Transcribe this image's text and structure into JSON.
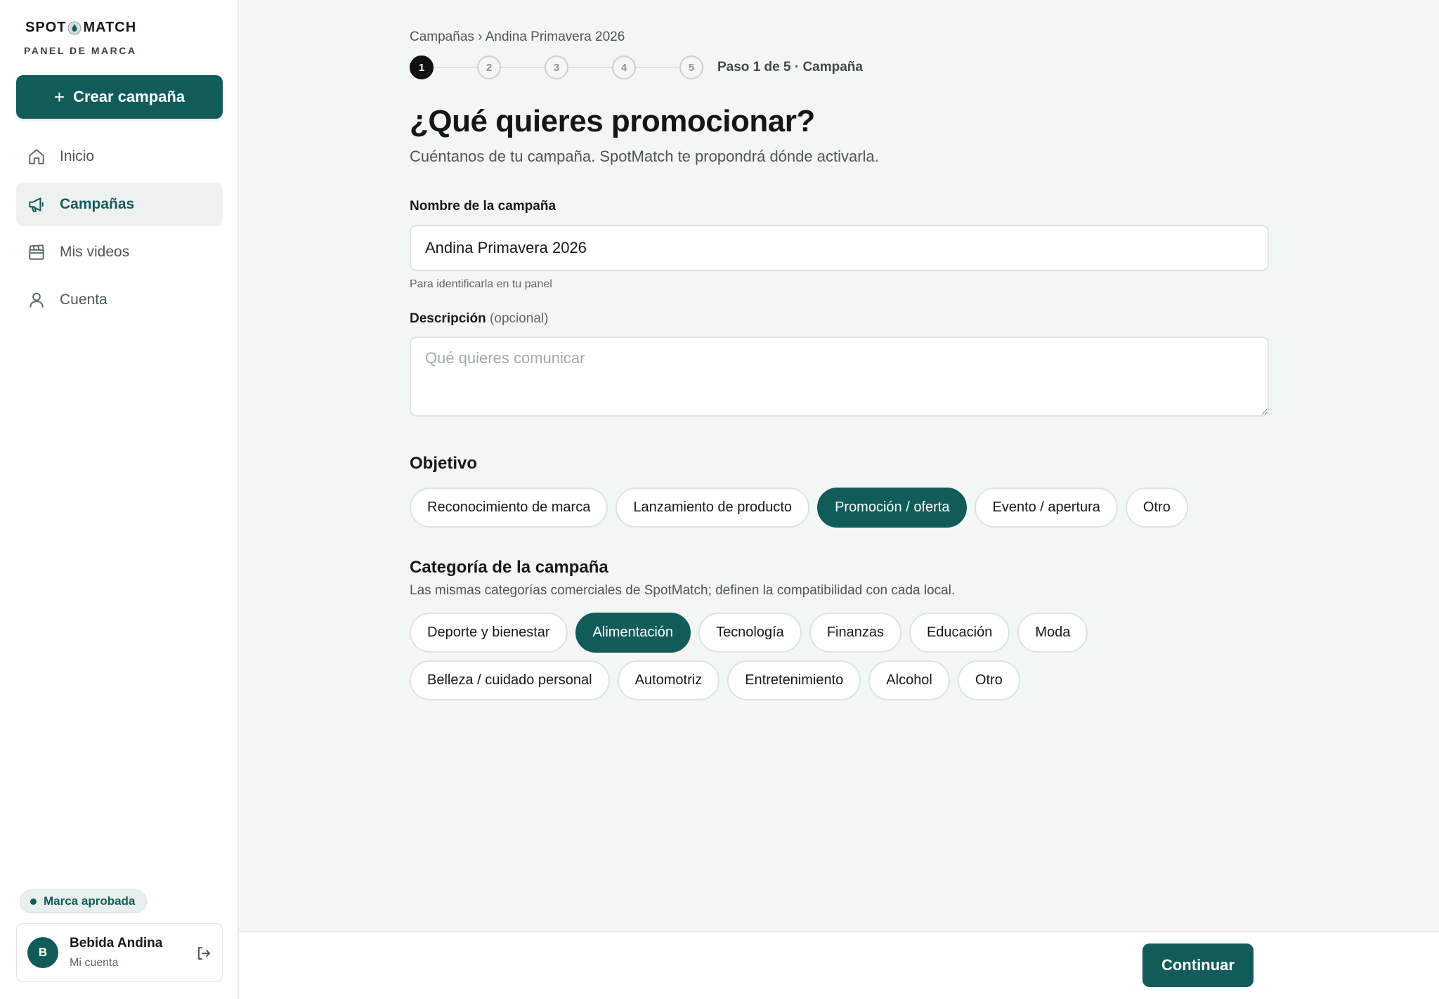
{
  "brand": {
    "logo_left": "SPOT",
    "logo_right": "MATCH",
    "subtitle": "PANEL DE MARCA"
  },
  "sidebar": {
    "create_label": "Crear campaña",
    "items": [
      {
        "label": "Inicio",
        "icon": "home-icon"
      },
      {
        "label": "Campañas",
        "icon": "megaphone-icon",
        "active": true
      },
      {
        "label": "Mis videos",
        "icon": "clapperboard-icon"
      },
      {
        "label": "Cuenta",
        "icon": "user-icon"
      }
    ],
    "status_badge": "Marca aprobada",
    "account": {
      "initial": "B",
      "name": "Bebida Andina",
      "sub": "Mi cuenta"
    }
  },
  "breadcrumb": "Campañas › Andina Primavera 2026",
  "stepper": {
    "steps": [
      "1",
      "2",
      "3",
      "4",
      "5"
    ],
    "current": 1,
    "label": "Paso 1 de 5 · Campaña"
  },
  "page": {
    "title": "¿Qué quieres promocionar?",
    "subtitle": "Cuéntanos de tu campaña. SpotMatch te propondrá dónde activarla."
  },
  "form": {
    "name_label": "Nombre de la campaña",
    "name_value": "Andina Primavera 2026",
    "name_hint": "Para identificarla en tu panel",
    "desc_label": "Descripción",
    "desc_optional": "(opcional)",
    "desc_placeholder": "Qué quieres comunicar"
  },
  "objective": {
    "title": "Objetivo",
    "options": [
      "Reconocimiento de marca",
      "Lanzamiento de producto",
      "Promoción / oferta",
      "Evento / apertura",
      "Otro"
    ],
    "selected": "Promoción / oferta"
  },
  "category": {
    "title": "Categoría de la campaña",
    "subtitle": "Las mismas categorías comerciales de SpotMatch; definen la compatibilidad con cada local.",
    "row1": [
      "Deporte y bienestar",
      "Alimentación",
      "Tecnología",
      "Finanzas",
      "Educación",
      "Moda"
    ],
    "row2": [
      "Belleza / cuidado personal",
      "Automotriz",
      "Entretenimiento",
      "Alcohol",
      "Otro"
    ],
    "selected": "Alimentación"
  },
  "footer": {
    "continue_label": "Continuar"
  },
  "colors": {
    "accent": "#115c5a",
    "background": "#f4f6f5"
  }
}
